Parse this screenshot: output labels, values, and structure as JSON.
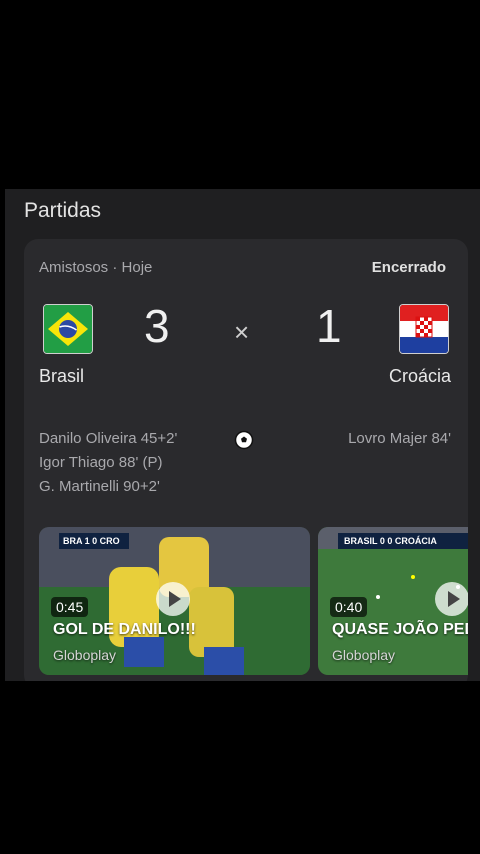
{
  "section": {
    "title": "Partidas"
  },
  "match": {
    "competition": "Amistosos",
    "separator": "·",
    "day": "Hoje",
    "status": "Encerrado",
    "home": {
      "name": "Brasil",
      "score": "3",
      "scorers": [
        "Danilo Oliveira 45+2'",
        "Igor Thiago 88' (P)",
        "G. Martinelli 90+2'"
      ]
    },
    "away": {
      "name": "Croácia",
      "score": "1",
      "scorers": [
        "Lovro Majer 84'"
      ]
    },
    "versus_symbol": "×"
  },
  "videos": [
    {
      "duration": "0:45",
      "title": "GOL DE DANILO!!!",
      "source": "Globoplay",
      "scorebug": "BRA 1 0 CRO"
    },
    {
      "duration": "0:40",
      "title": "QUASE JOÃO PED",
      "source": "Globoplay",
      "scorebug": "BRASIL 0 0 CROÁCIA"
    }
  ],
  "colors": {
    "background": "#000000",
    "panel": "#1f1f21",
    "card": "#2a2a2d",
    "muted_text": "#a9a9ad"
  }
}
